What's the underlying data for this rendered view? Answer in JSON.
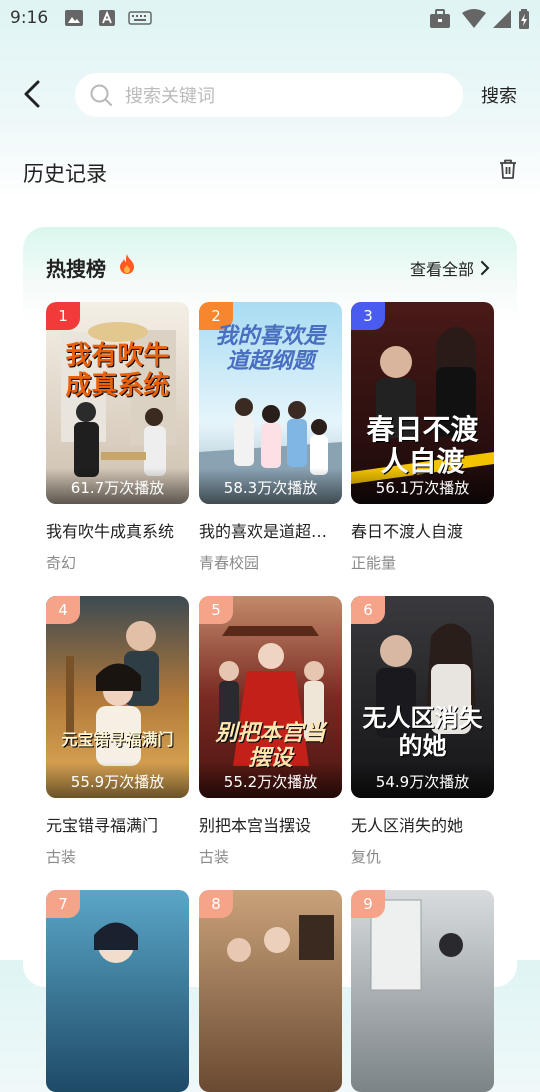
{
  "status_bar": {
    "time": "9:16"
  },
  "search": {
    "placeholder": "搜索关键词",
    "value": "",
    "button_label": "搜索"
  },
  "history": {
    "title": "历史记录"
  },
  "hot_list": {
    "title": "热搜榜",
    "view_all_label": "查看全部",
    "items": [
      {
        "rank": "1",
        "plays": "61.7万次播放",
        "name": "我有吹牛成真系统",
        "tag": "奇幻",
        "cover_text": "我有吹牛成真系统"
      },
      {
        "rank": "2",
        "plays": "58.3万次播放",
        "name": "我的喜欢是道超纲…",
        "tag": "青春校园",
        "cover_text": "我的喜欢是道超纲题"
      },
      {
        "rank": "3",
        "plays": "56.1万次播放",
        "name": "春日不渡人自渡",
        "tag": "正能量",
        "cover_text": "春日不渡人自渡"
      },
      {
        "rank": "4",
        "plays": "55.9万次播放",
        "name": "元宝错寻福满门",
        "tag": "古装",
        "cover_text": "元宝错寻福满门"
      },
      {
        "rank": "5",
        "plays": "55.2万次播放",
        "name": "别把本宫当摆设",
        "tag": "古装",
        "cover_text": "别把本宫当摆设"
      },
      {
        "rank": "6",
        "plays": "54.9万次播放",
        "name": "无人区消失的她",
        "tag": "复仇",
        "cover_text": "无人区消失的她"
      },
      {
        "rank": "7"
      },
      {
        "rank": "8"
      },
      {
        "rank": "9"
      }
    ]
  },
  "colors": {
    "rank_1": "#f23a3a",
    "rank_2": "#f7862e",
    "rank_3": "#4a5cf0",
    "rank_other": "#f5a48a",
    "flame": "#ff5a1f"
  }
}
